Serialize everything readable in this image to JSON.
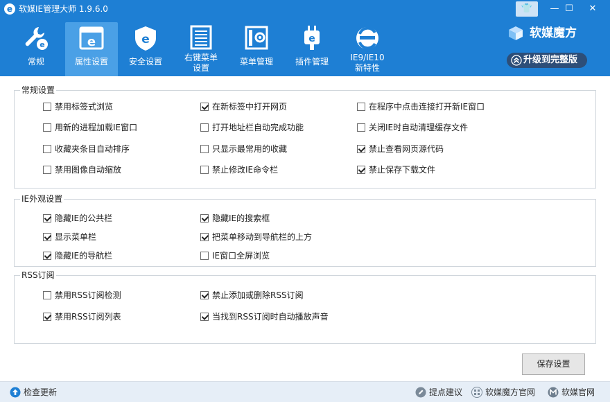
{
  "window": {
    "logo_glyph": "e",
    "title": "软媒IE管理大师 1.9.6.0",
    "skin_glyph": "👕",
    "minimize_glyph": "—",
    "maximize_glyph": "☐",
    "close_glyph": "✕"
  },
  "nav": {
    "items": [
      {
        "label": "常规",
        "icon": "wrench-e-icon"
      },
      {
        "label": "属性设置",
        "icon": "property-window-icon",
        "active": true
      },
      {
        "label": "安全设置",
        "icon": "shield-e-icon"
      },
      {
        "label": "右键菜单设置",
        "icon": "context-menu-icon"
      },
      {
        "label": "菜单管理",
        "icon": "menu-manage-icon"
      },
      {
        "label": "插件管理",
        "icon": "plugin-icon"
      },
      {
        "label": "IE9/IE10新特性",
        "icon": "ie-logo-icon"
      }
    ],
    "labels": {
      "general": "常规",
      "property": "属性设置",
      "security": "安全设置",
      "context_line1": "右键菜单",
      "context_line2": "设置",
      "menu": "菜单管理",
      "plugin": "插件管理",
      "ie_line1": "IE9/IE10",
      "ie_line2": "新特性"
    }
  },
  "brand": {
    "name": "软媒魔方",
    "upgrade_label": "升级到完整版"
  },
  "groups": {
    "general": {
      "title": "常规设置",
      "options": [
        {
          "label": "禁用标签式浏览",
          "checked": false
        },
        {
          "label": "在新标签中打开网页",
          "checked": true
        },
        {
          "label": "在程序中点击连接打开新IE窗口",
          "checked": false
        },
        {
          "label": "用新的进程加载IE窗口",
          "checked": false
        },
        {
          "label": "打开地址栏自动完成功能",
          "checked": false
        },
        {
          "label": "关闭IE时自动清理缓存文件",
          "checked": false
        },
        {
          "label": "收藏夹条目自动排序",
          "checked": false
        },
        {
          "label": "只显示最常用的收藏",
          "checked": false
        },
        {
          "label": "禁止查看网页源代码",
          "checked": true
        },
        {
          "label": "禁用图像自动缩放",
          "checked": false
        },
        {
          "label": "禁止修改IE命令栏",
          "checked": false
        },
        {
          "label": "禁止保存下载文件",
          "checked": true
        }
      ]
    },
    "appearance": {
      "title": "IE外观设置",
      "options": [
        {
          "label": "隐藏IE的公共栏",
          "checked": true
        },
        {
          "label": "隐藏IE的搜索框",
          "checked": true
        },
        {
          "label": "显示菜单栏",
          "checked": true
        },
        {
          "label": "把菜单移动到导航栏的上方",
          "checked": true
        },
        {
          "label": "隐藏IE的导航栏",
          "checked": true
        },
        {
          "label": "IE窗口全屏浏览",
          "checked": false
        }
      ]
    },
    "rss": {
      "title": "RSS订阅",
      "options": [
        {
          "label": "禁用RSS订阅检测",
          "checked": false
        },
        {
          "label": "禁止添加或删除RSS订阅",
          "checked": true
        },
        {
          "label": "禁用RSS订阅列表",
          "checked": true
        },
        {
          "label": "当找到RSS订阅时自动播放声音",
          "checked": true
        }
      ]
    }
  },
  "actions": {
    "save_label": "保存设置"
  },
  "footer": {
    "check_update": "检查更新",
    "feedback": "提点建议",
    "mofang_site": "软媒魔方官网",
    "ruanmei_site": "软媒官网"
  },
  "colors": {
    "header_bg": "#1e7fd4",
    "active_tab_bg": "#4aa0e6",
    "upgrade_bg": "#2d4e78",
    "footer_bg": "#e6eef7"
  }
}
